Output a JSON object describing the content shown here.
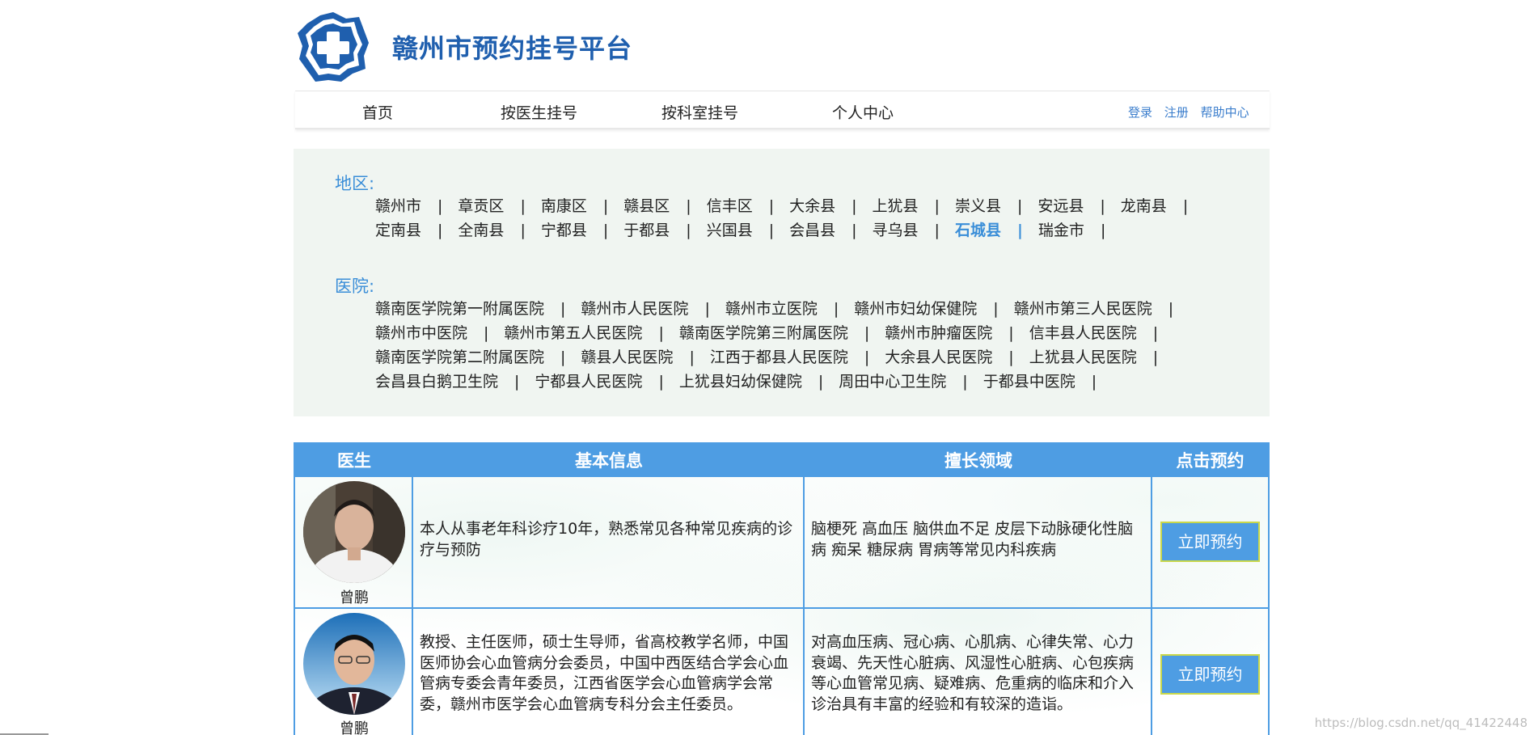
{
  "site": {
    "title": "赣州市预约挂号平台",
    "logo_icon": "medical-cross-icon"
  },
  "nav": {
    "items": [
      "首页",
      "按医生挂号",
      "按科室挂号",
      "个人中心"
    ],
    "links": [
      "登录",
      "注册",
      "帮助中心"
    ]
  },
  "filter": {
    "region_label": "地区:",
    "regions_row1": [
      "赣州市",
      "章贡区",
      "南康区",
      "赣县区",
      "信丰区",
      "大余县",
      "上犹县",
      "崇义县",
      "安远县",
      "龙南县"
    ],
    "regions_row2": [
      "定南县",
      "全南县",
      "宁都县",
      "于都县",
      "兴国县",
      "会昌县",
      "寻乌县",
      "石城县",
      "瑞金市"
    ],
    "active_region": "石城县",
    "hospital_label": "医院:",
    "hospitals_row1": [
      "赣南医学院第一附属医院",
      "赣州市人民医院",
      "赣州市立医院",
      "赣州市妇幼保健院",
      "赣州市第三人民医院"
    ],
    "hospitals_row2": [
      "赣州市中医院",
      "赣州市第五人民医院",
      "赣南医学院第三附属医院",
      "赣州市肿瘤医院",
      "信丰县人民医院"
    ],
    "hospitals_row3": [
      "赣南医学院第二附属医院",
      "赣县人民医院",
      "江西于都县人民医院",
      "大余县人民医院",
      "上犹县人民医院"
    ],
    "hospitals_row4": [
      "会昌县白鹅卫生院",
      "宁都县人民医院",
      "上犹县妇幼保健院",
      "周田中心卫生院",
      "于都县中医院"
    ],
    "separator": "|"
  },
  "table": {
    "headers": [
      "医生",
      "基本信息",
      "擅长领域",
      "点击预约"
    ],
    "rows": [
      {
        "name": "曾鹏",
        "info": "本人从事老年科诊疗10年，熟悉常见各种常见疾病的诊疗与预防",
        "expertise": "脑梗死 高血压 脑供血不足 皮层下动脉硬化性脑病 痴呆 糖尿病 胃病等常见内科疾病",
        "button": "立即预约"
      },
      {
        "name": "曾鹏",
        "info": "教授、主任医师，硕士生导师，省高校教学名师，中国医师协会心血管病分会委员，中国中西医结合学会心血管病专委会青年委员，江西省医学会心血管病学会常委，赣州市医学会心血管病专科分会主任委员。",
        "expertise": "对高血压病、冠心病、心肌病、心律失常、心力衰竭、先天性心脏病、风湿性心脏病、心包疾病等心血管常见病、疑难病、危重病的临床和介入诊治具有丰富的经验和有较深的造诣。",
        "button": "立即预约"
      }
    ]
  },
  "watermark": "https://blog.csdn.net/qq_41422448",
  "colors": {
    "accent": "#4e9de3",
    "title": "#1f5fae",
    "filter_bg": "#f0f5f1",
    "active": "#3a8ed8"
  }
}
